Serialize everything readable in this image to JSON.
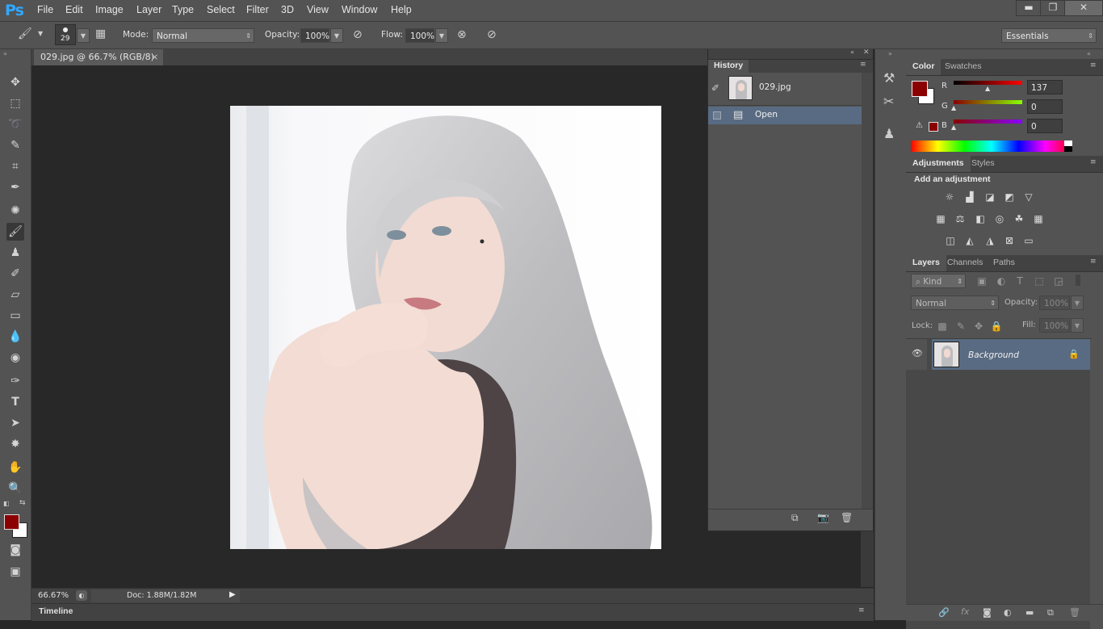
{
  "app": {
    "logo": "Ps"
  },
  "menu": [
    "File",
    "Edit",
    "Image",
    "Layer",
    "Type",
    "Select",
    "Filter",
    "3D",
    "View",
    "Window",
    "Help"
  ],
  "window_controls": {
    "minimize": "▬",
    "restore": "❐",
    "close": "✕"
  },
  "options": {
    "brush_size": "29",
    "mode_label": "Mode:",
    "mode_value": "Normal",
    "opacity_label": "Opacity:",
    "opacity_value": "100%",
    "flow_label": "Flow:",
    "flow_value": "100%",
    "workspace": "Essentials"
  },
  "document": {
    "tab_title": "029.jpg @ 66.7% (RGB/8)",
    "close": "×",
    "zoom": "66.67%",
    "doc_info": "Doc: 1.88M/1.82M",
    "timeline_label": "Timeline"
  },
  "history": {
    "tab": "History",
    "snapshot": "029.jpg",
    "steps": [
      {
        "label": "Open"
      }
    ]
  },
  "color_panel": {
    "tabs": [
      "Color",
      "Swatches"
    ],
    "channels": [
      {
        "label": "R",
        "value": "137"
      },
      {
        "label": "G",
        "value": "0"
      },
      {
        "label": "B",
        "value": "0"
      }
    ],
    "foreground": "#890000",
    "background": "#ffffff"
  },
  "adjustments_panel": {
    "tabs": [
      "Adjustments",
      "Styles"
    ],
    "heading": "Add an adjustment"
  },
  "layers_panel": {
    "tabs": [
      "Layers",
      "Channels",
      "Paths"
    ],
    "filter_kind": "Kind",
    "blend_mode": "Normal",
    "opacity_label": "Opacity:",
    "opacity_value": "100%",
    "lock_label": "Lock:",
    "fill_label": "Fill:",
    "fill_value": "100%",
    "layers": [
      {
        "name": "Background"
      }
    ]
  },
  "colors": {
    "accent": "#31a8ff",
    "selection": "#596b82",
    "foreground_swatch": "#8b0000"
  }
}
